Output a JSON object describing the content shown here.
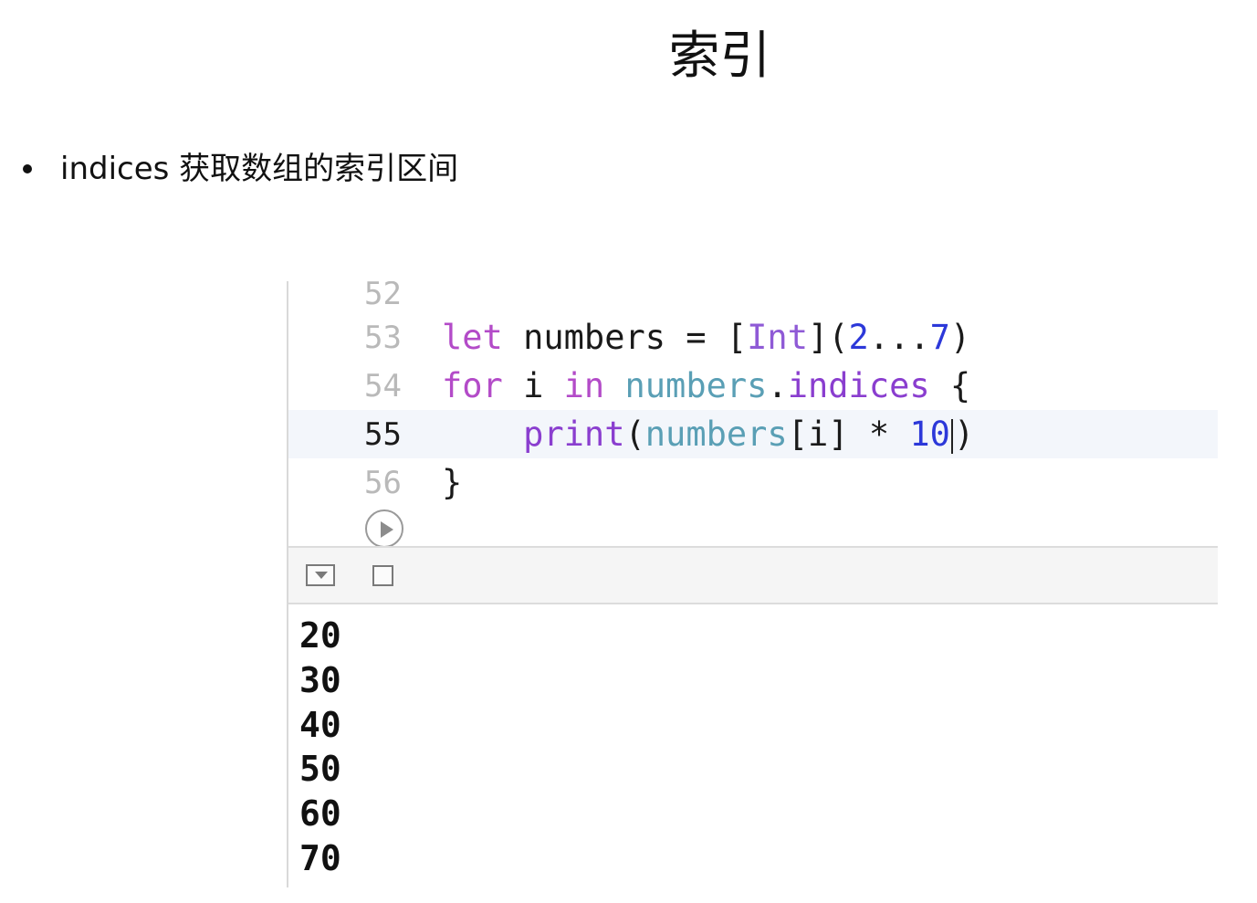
{
  "slide": {
    "title": "索引",
    "bullet": "indices 获取数组的索引区间"
  },
  "editor": {
    "lines": [
      {
        "number": "52",
        "text": ""
      },
      {
        "number": "53",
        "text": "let numbers = [Int](2...7)"
      },
      {
        "number": "54",
        "text": "for i in numbers.indices {"
      },
      {
        "number": "55",
        "text": "    print(numbers[i] * 10)"
      },
      {
        "number": "56",
        "text": "}"
      }
    ],
    "tokens": {
      "let": "let",
      "numbers_decl": " numbers = [",
      "int": "Int",
      "paren_open": "](",
      "two": "2",
      "range": "...",
      "seven": "7",
      "paren_close": ")",
      "for": "for",
      "i_sp": " i ",
      "in": "in",
      "sp": " ",
      "numbers_ref": "numbers",
      "dot": ".",
      "indices": "indices",
      "brace_open": " {",
      "indent": "    ",
      "print": "print",
      "lparen": "(",
      "numbers_ref2": "numbers",
      "index_expr": "[i] * ",
      "ten": "10",
      "rparen": ")",
      "brace_close": "}"
    },
    "current_line": "55"
  },
  "debug": {
    "hide_icon": "hide-debug-area-icon",
    "clear_icon": "clear-console-icon"
  },
  "console": {
    "output": [
      "20",
      "30",
      "40",
      "50",
      "60",
      "70"
    ]
  },
  "colors": {
    "keyword": "#b34bc8",
    "type": "#8f5ad6",
    "number": "#2c38d9",
    "variable": "#5a9fb5",
    "function": "#8a3ecf"
  }
}
